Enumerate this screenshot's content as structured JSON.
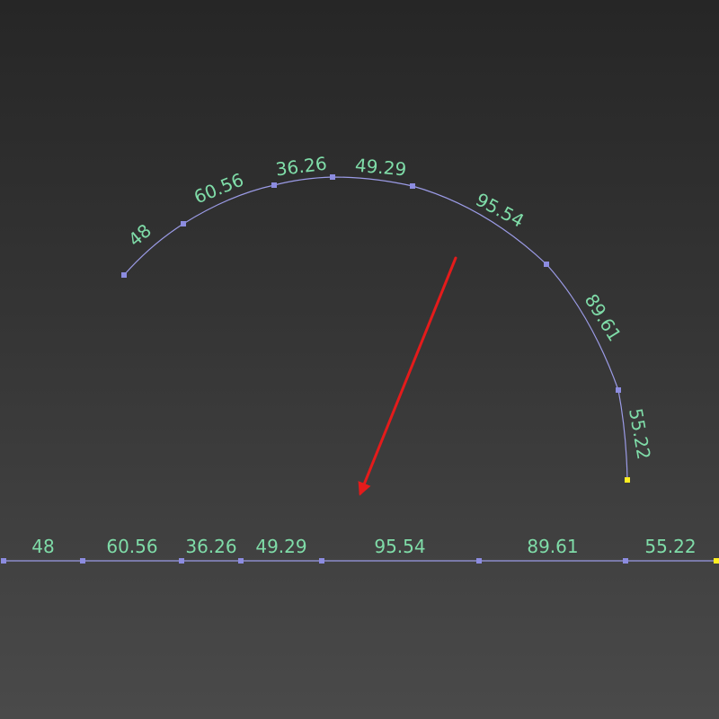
{
  "segments": [
    "48",
    "60.56",
    "36.26",
    "49.29",
    "95.54",
    "89.61",
    "55.22"
  ],
  "colors": {
    "curve": "#9b9be6",
    "vertex": "#8c8ce0",
    "end_vertex": "#ffee22",
    "label": "#7fdca8",
    "arrow": "#e41b1b"
  }
}
